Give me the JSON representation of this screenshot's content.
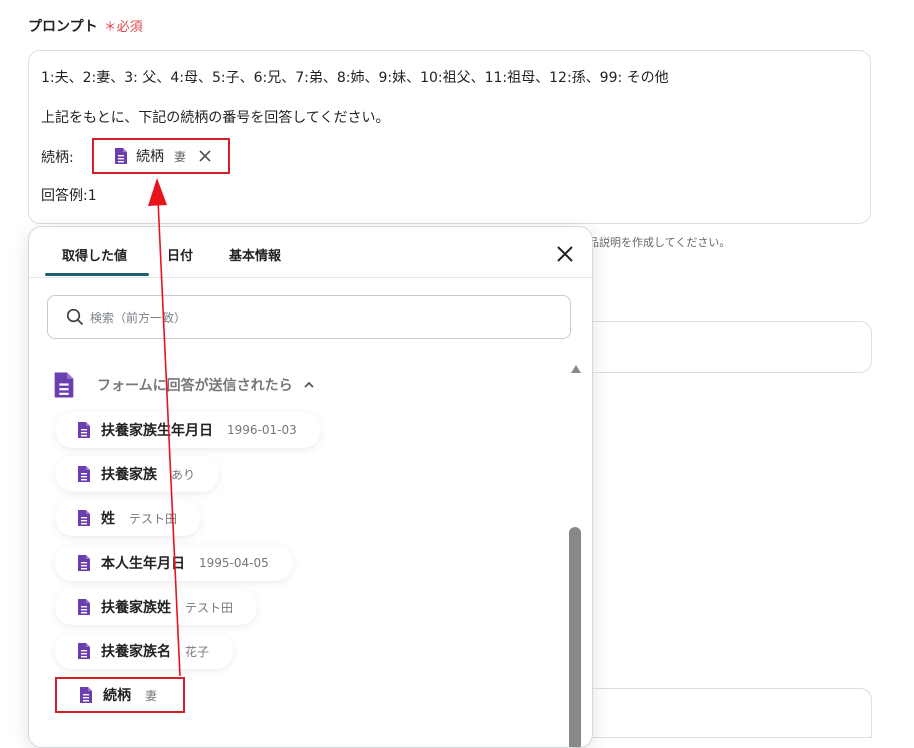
{
  "field": {
    "label": "プロンプト",
    "required": "＊必須"
  },
  "prompt": {
    "line1": "1:夫、2:妻、3: 父、4:母、5:子、6:兄、7:弟、8:姉、9:妹、10:祖父、11:祖母、12:孫、99: その他",
    "line2": "上記をもとに、下記の続柄の番号を回答してください。",
    "line3_label": "続柄:",
    "chip_name": "続柄",
    "chip_value": "妻",
    "line4": "回答例:1"
  },
  "helper_text": "品説明を作成してください。",
  "popup": {
    "tabs": [
      "取得した値",
      "日付",
      "基本情報"
    ],
    "active_tab": "取得した値",
    "search_placeholder": "検索（前方一致）",
    "section_title": "フォームに回答が送信されたら",
    "items": [
      {
        "name": "扶養家族生年月日",
        "value": "1996-01-03"
      },
      {
        "name": "扶養家族",
        "value": "あり"
      },
      {
        "name": "姓",
        "value": "テスト田"
      },
      {
        "name": "本人生年月日",
        "value": "1995-04-05"
      },
      {
        "name": "扶養家族姓",
        "value": "テスト田"
      },
      {
        "name": "扶養家族名",
        "value": "花子"
      },
      {
        "name": "続柄",
        "value": "妻"
      }
    ]
  },
  "colors": {
    "accent": "#1e5f74",
    "highlight": "#d9202a",
    "doc_icon": "#6b3fb0",
    "required": "#e5484d"
  },
  "icons": [
    "document-icon",
    "close-icon",
    "search-icon",
    "chevron-up-icon",
    "arrow-up-icon"
  ]
}
